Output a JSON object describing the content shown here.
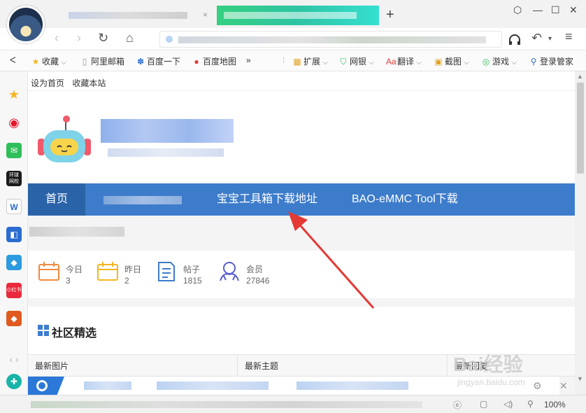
{
  "window_controls": {
    "skin": "⬡",
    "minimize": "—",
    "maximize": "☐",
    "close": "✕"
  },
  "tabs": {
    "close": "×",
    "new": "+"
  },
  "nav": {
    "back": "‹",
    "forward": "›",
    "refresh": "↻",
    "home": "⌂",
    "undo": "↶",
    "more": "▾"
  },
  "bookmarks": {
    "collapse": "ᐸ",
    "items": [
      {
        "label": "收藏",
        "icon": "star-icon",
        "arrow": "⌵"
      },
      {
        "label": "阿里邮箱",
        "icon": "document-icon"
      },
      {
        "label": "百度一下",
        "icon": "paw-icon"
      },
      {
        "label": "百度地图",
        "icon": "map-pin-icon"
      },
      {
        "label": "»",
        "icon": ""
      }
    ],
    "tools": [
      {
        "label": "扩展",
        "icon": "extension-icon"
      },
      {
        "label": "网银",
        "icon": "shield-icon"
      },
      {
        "label": "翻译",
        "icon": "translate-icon"
      },
      {
        "label": "截图",
        "icon": "screenshot-icon"
      },
      {
        "label": "游戏",
        "icon": "gamepad-icon"
      },
      {
        "label": "登录管家",
        "icon": "search-key-icon"
      }
    ]
  },
  "sidebar_icons": [
    {
      "name": "favorites-icon",
      "color": "#f5b623",
      "glyph": "★"
    },
    {
      "name": "weibo-icon",
      "color": "#e6162d",
      "glyph": "◉"
    },
    {
      "name": "mail-icon",
      "color": "#2fbf5a",
      "glyph": "✉"
    },
    {
      "name": "global-net-icon",
      "color": "#1a1a1a",
      "glyph": "环球\n网校"
    },
    {
      "name": "word-icon",
      "color": "#2b6cd1",
      "glyph": "W"
    },
    {
      "name": "chat-icon",
      "color": "#2b6cd1",
      "glyph": "◧"
    },
    {
      "name": "game-a-icon",
      "color": "#2c9be0",
      "glyph": "◆"
    },
    {
      "name": "xiaohongshu-icon",
      "color": "#ea2a3c",
      "glyph": "小红书"
    },
    {
      "name": "game-b-icon",
      "color": "#e05a1f",
      "glyph": "◆"
    },
    {
      "name": "sidebar-expand-icon",
      "color": "#bbbbbb",
      "glyph": "‹ ›"
    },
    {
      "name": "add-service-icon",
      "color": "#18b4a8",
      "glyph": "✚"
    }
  ],
  "site": {
    "topbar": {
      "set_home": "设为首页",
      "bookmark": "收藏本站"
    },
    "nav": {
      "home": "首页",
      "toolbox": "宝宝工具箱下载地址",
      "emmc": "BAO-eMMC Tool下载"
    },
    "stats": [
      {
        "label": "今日",
        "value": "3",
        "icon": "calendar-today-icon",
        "color": "#f08a3c"
      },
      {
        "label": "昨日",
        "value": "2",
        "icon": "calendar-yesterday-icon",
        "color": "#f5b623"
      },
      {
        "label": "帖子",
        "value": "1815",
        "icon": "posts-icon",
        "color": "#3d7ccb"
      },
      {
        "label": "会员",
        "value": "27846",
        "icon": "members-icon",
        "color": "#5a5fcf"
      }
    ],
    "section_title": "社区精选",
    "table_headers": [
      "最新图片",
      "最新主题",
      "最新回复"
    ]
  },
  "status": {
    "zoom": "100%"
  },
  "watermark": {
    "brand": "Bai经验",
    "url": "jingyan.baidu.com"
  },
  "colors": {
    "nav_blue": "#3d7ccb",
    "nav_active": "#2b63a8",
    "annotation_red": "#e53935"
  }
}
